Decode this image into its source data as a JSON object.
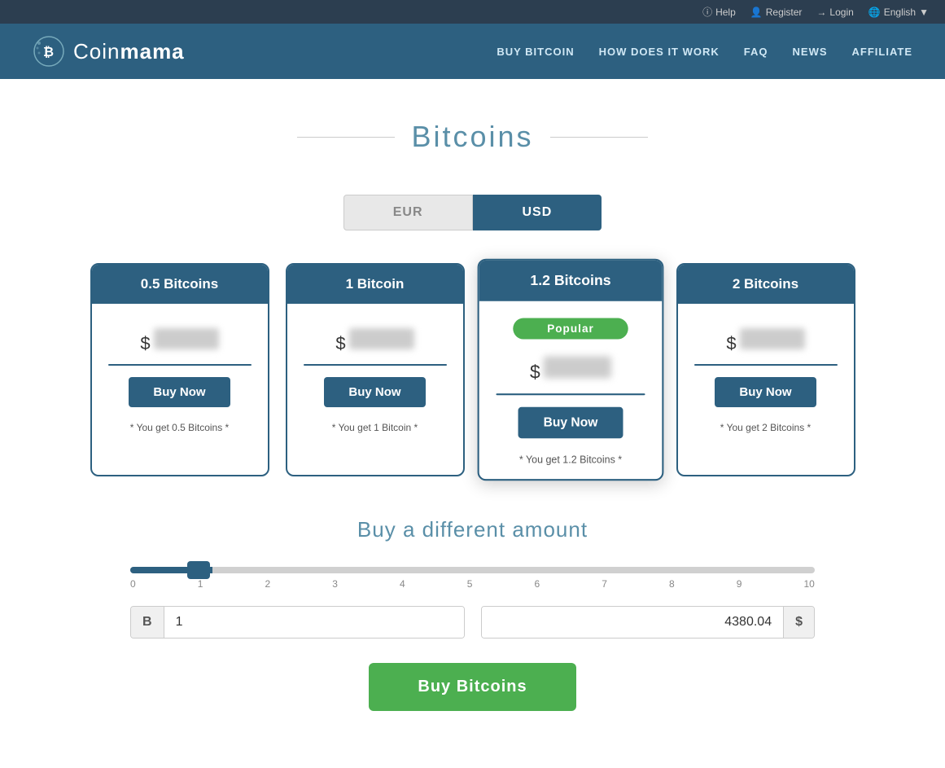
{
  "topbar": {
    "help_label": "Help",
    "register_label": "Register",
    "login_label": "Login",
    "language_label": "English"
  },
  "header": {
    "logo_text_light": "Coin",
    "logo_text_bold": "mama",
    "nav": {
      "buy_bitcoin": "BUY BITCOIN",
      "how_it_works": "HOW DOES IT WORK",
      "faq": "FAQ",
      "news": "NEWS",
      "affiliate": "AFFILIATE"
    }
  },
  "page": {
    "title": "Bitcoins",
    "currency_eur": "EUR",
    "currency_usd": "USD",
    "active_currency": "USD"
  },
  "cards": [
    {
      "id": "card-05",
      "title": "0.5 Bitcoins",
      "dollar_sign": "$",
      "buy_label": "Buy Now",
      "you_get": "* You get 0.5 Bitcoins *",
      "featured": false,
      "popular": false
    },
    {
      "id": "card-1",
      "title": "1 Bitcoin",
      "dollar_sign": "$",
      "buy_label": "Buy Now",
      "you_get": "* You get 1 Bitcoin *",
      "featured": false,
      "popular": false
    },
    {
      "id": "card-12",
      "title": "1.2 Bitcoins",
      "dollar_sign": "$",
      "buy_label": "Buy Now",
      "you_get": "* You get 1.2 Bitcoins *",
      "featured": true,
      "popular": true,
      "popular_label": "Popular"
    },
    {
      "id": "card-2",
      "title": "2 Bitcoins",
      "dollar_sign": "$",
      "buy_label": "Buy Now",
      "you_get": "* You get 2 Bitcoins *",
      "featured": false,
      "popular": false
    }
  ],
  "custom_section": {
    "title": "Buy a different amount",
    "slider_min": "0",
    "slider_max": "10",
    "slider_labels": [
      "0",
      "1",
      "2",
      "3",
      "4",
      "5",
      "6",
      "7",
      "8",
      "9",
      "10"
    ],
    "slider_value": 1,
    "btc_prefix": "B",
    "btc_value": "1",
    "usd_value": "4380.04",
    "usd_suffix": "$",
    "buy_button": "Buy Bitcoins"
  },
  "colors": {
    "primary": "#2d6080",
    "green": "#4caf50",
    "light_text": "#5a8fa8"
  }
}
